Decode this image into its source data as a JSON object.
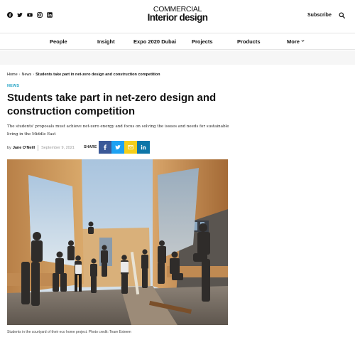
{
  "header": {
    "social_icons": [
      "facebook-icon",
      "twitter-icon",
      "youtube-icon",
      "instagram-icon",
      "linkedin-icon"
    ],
    "logo_line1": "COMMERCIAL",
    "logo_line2": "Interior design",
    "subscribe_label": "Subscribe",
    "search_icon": "search-icon"
  },
  "nav": {
    "items": [
      "People",
      "Insight",
      "Expo 2020 Dubai",
      "Projects",
      "Products",
      "More"
    ]
  },
  "article": {
    "breadcrumb": [
      "Home",
      "News",
      "Students take part in net-zero design and construction competition"
    ],
    "category": "NEWS",
    "headline": "Students take part in net-zero design and construction competition",
    "standfirst": "The students' proposals must achieve net-zero energy and focus on solving the issues and needs for sustainable living in the Middle East",
    "byline_prefix": "by",
    "author": "Jane O'Neill",
    "date": "September 9, 2021",
    "share_label": "SHARE",
    "share_buttons": [
      "facebook",
      "twitter",
      "email",
      "linkedin"
    ],
    "caption": "Students in the courtyard of their eco home project. Photo credit: Team Esteem"
  },
  "colors": {
    "accent": "#2aa6c7",
    "facebook": "#3b5998",
    "twitter": "#1da1f2",
    "email": "#f4ce1b",
    "linkedin": "#0e76a8"
  }
}
